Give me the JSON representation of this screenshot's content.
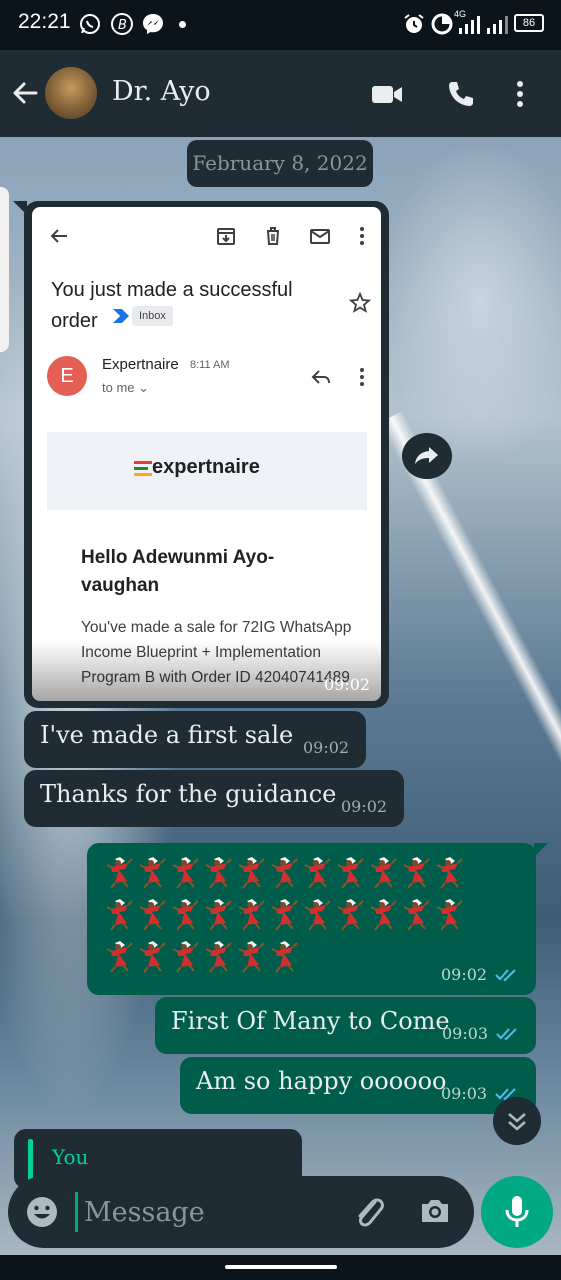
{
  "status_bar": {
    "time": "22:21",
    "network": "4G",
    "battery": "86",
    "icons": [
      "whatsapp-icon",
      "b-icon",
      "messenger-icon",
      "dot-icon",
      "alarm-icon",
      "data-saver-icon",
      "signal-icon",
      "signal-icon",
      "battery-icon"
    ]
  },
  "header": {
    "contact_name": "Dr. Ayo",
    "icons": [
      "back-arrow-icon",
      "avatar",
      "video-call-icon",
      "voice-call-icon",
      "more-options-icon"
    ]
  },
  "chat": {
    "date_chip": "February 8, 2022",
    "image_message": {
      "time": "09:02",
      "email_screenshot": {
        "subject": "You just made a successful order",
        "label": "Inbox",
        "sender_initial": "E",
        "sender_name": "Expertnaire",
        "sender_time": "8:11 AM",
        "recipient": "to me ⌄",
        "logo_text": "expertnaire",
        "logo_colors": [
          "#e53935",
          "#2e7d32",
          "#f9a825"
        ],
        "greeting": "Hello Adewunmi Ayo-vaughan",
        "body": "You've made a sale for 72IG WhatsApp Income Blueprint + Implementation Program B with Order ID 42040741489"
      }
    },
    "messages": [
      {
        "direction": "in",
        "text": "I've made a first sale",
        "time": "09:02"
      },
      {
        "direction": "in",
        "text": "Thanks for the guidance",
        "time": "09:02"
      },
      {
        "direction": "out",
        "type": "emoji",
        "emoji_count": 28,
        "emoji_name": "dancer",
        "time": "09:02",
        "status": "read"
      },
      {
        "direction": "out",
        "text": "First Of Many to Come",
        "time": "09:03",
        "status": "read"
      },
      {
        "direction": "out",
        "text": "Am so happy oooooo",
        "time": "09:03",
        "status": "read"
      }
    ],
    "reply_preview": {
      "author": "You"
    }
  },
  "input": {
    "placeholder": "Message",
    "icons": [
      "emoji-icon",
      "attach-icon",
      "camera-icon",
      "mic-icon"
    ]
  },
  "colors": {
    "header_bg": "#1f2c34",
    "incoming_bubble": "#1f2c34",
    "outgoing_bubble": "#005c4b",
    "accent": "#00a884",
    "read_ticks": "#53bdeb"
  }
}
